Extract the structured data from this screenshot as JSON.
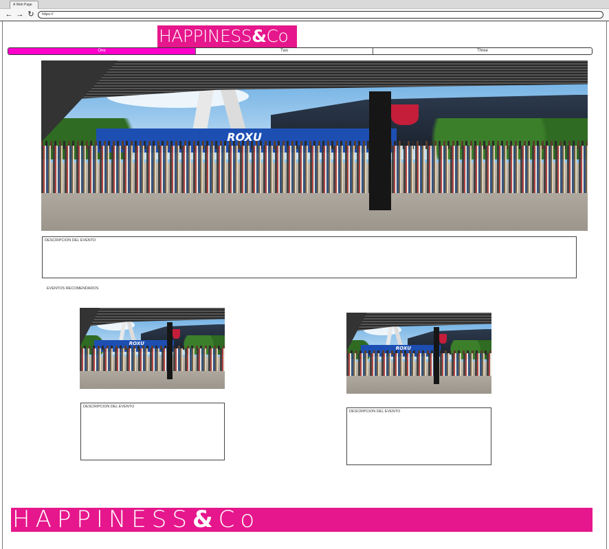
{
  "browser": {
    "tab_title": "A Web Page",
    "url": "https://",
    "back_icon": "arrow-left-icon",
    "forward_icon": "arrow-right-icon",
    "reload_icon": "reload-icon"
  },
  "brand": {
    "name_part1": "HAPPINESS",
    "amp": "&",
    "name_part2": "Co",
    "color": "#e6178c"
  },
  "tabs": [
    {
      "label": "One",
      "active": true
    },
    {
      "label": "Two",
      "active": false
    },
    {
      "label": "Three",
      "active": false
    }
  ],
  "hero": {
    "image_text": "ROXU",
    "description_label": "DESCRIPCION DEL EVENTO"
  },
  "recommended": {
    "section_label": "EVENTOS RECOMENDADOS",
    "cards": [
      {
        "image_text": "ROXU",
        "description_label": "DESCRIPCION DEL EVENTO"
      },
      {
        "image_text": "ROXU",
        "description_label": "DESCRIPCION DEL EVENTO"
      }
    ]
  },
  "colors": {
    "active_tab": "#ff00cc",
    "brand": "#e6178c"
  }
}
